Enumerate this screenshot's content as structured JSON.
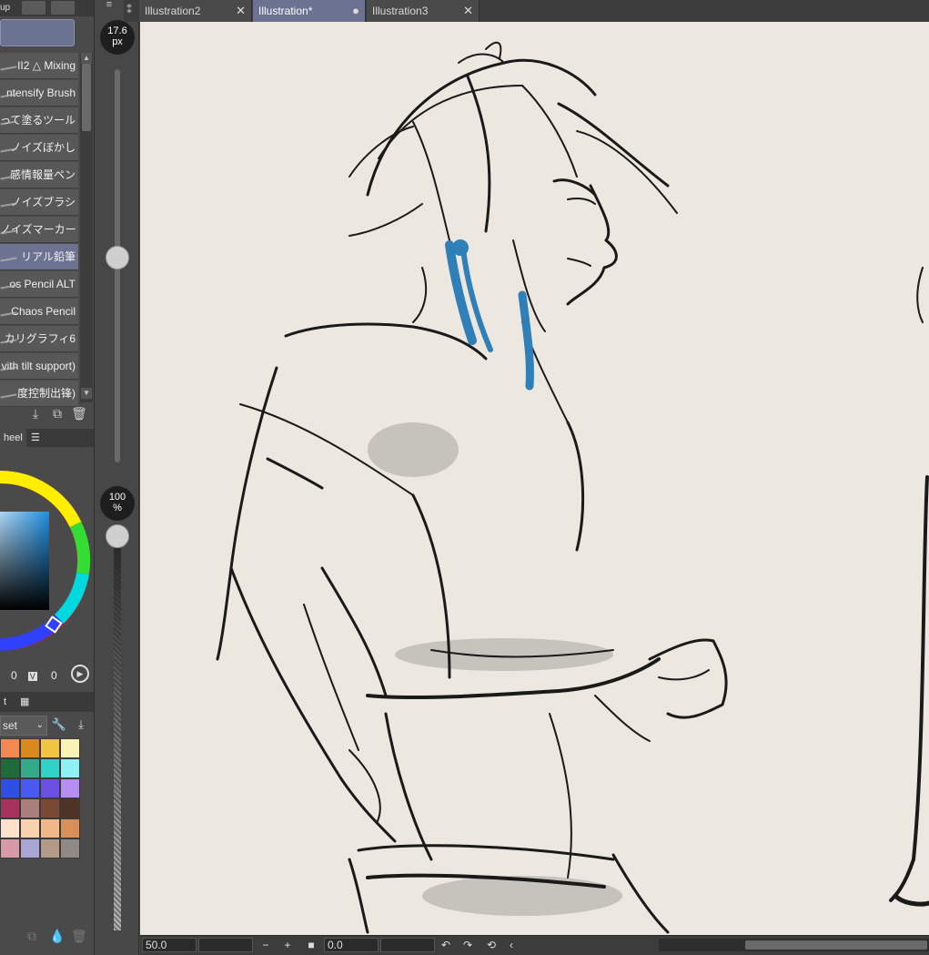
{
  "left_panel": {
    "top_tab_text": "up",
    "brushes": [
      {
        "label": "II2 △ Mixing",
        "selected": false
      },
      {
        "label": "ntensify Brush",
        "selected": false
      },
      {
        "label": "って塗るツール",
        "selected": false
      },
      {
        "label": "ノイズぼかし",
        "selected": false
      },
      {
        "label": "感情報量ペン",
        "selected": false
      },
      {
        "label": "ノイズブラシ",
        "selected": false
      },
      {
        "label": "ノイズマーカー",
        "selected": false
      },
      {
        "label": "リアル鉛筆",
        "selected": true
      },
      {
        "label": "os Pencil ALT",
        "selected": false
      },
      {
        "label": "Chaos Pencil",
        "selected": false
      },
      {
        "label": "カリグラフィ6",
        "selected": false
      },
      {
        "label": "vith tilt support)",
        "selected": false
      },
      {
        "label": "度控制出锋)",
        "selected": false
      }
    ],
    "color_panel_tab": "heel",
    "color_values": {
      "first": "0",
      "badge": "V",
      "second": "0"
    },
    "palette_tab": "t",
    "palette_select": "set",
    "swatches": [
      "#f08a50",
      "#d98a1e",
      "#f2c542",
      "#fbf3b6",
      "#1f6b3a",
      "#35a98a",
      "#2fd3c8",
      "#8ff0f5",
      "#2f4fe0",
      "#4a5af0",
      "#6a4fe0",
      "#b58ef0",
      "#a8325e",
      "#a87f7a",
      "#7a4a36",
      "#4d3424",
      "#fde0cd",
      "#fbd2ae",
      "#efb98a",
      "#d88f58",
      "#d99aa8",
      "#a9a6d6",
      "#b39a86",
      "#8f8a86"
    ]
  },
  "sliders": {
    "brush_size": "17.6\npx",
    "brush_size_value": "17.6",
    "brush_size_unit": "px",
    "opacity_value": "100",
    "opacity_unit": "%",
    "brush_size_level": 0.18,
    "opacity_level": 1.0
  },
  "tabs": [
    {
      "label": "Illustration2",
      "active": false,
      "close": "✕"
    },
    {
      "label": "Illustration*",
      "active": true,
      "close": "●"
    },
    {
      "label": "Illustration3",
      "active": false,
      "close": "✕"
    }
  ],
  "status_bar": {
    "zoom": "50.0",
    "minus": "−",
    "plus": "+",
    "rotation": "0.0"
  },
  "colors": {
    "accent": "#6b7391",
    "canvas": "#ece8e0",
    "ink": "#1a1a1a",
    "hair_blue": "#2f7fb8"
  }
}
